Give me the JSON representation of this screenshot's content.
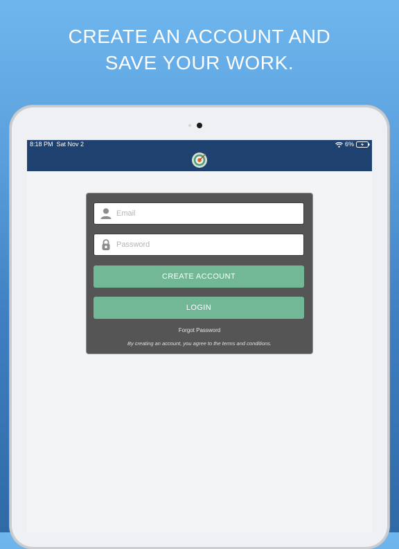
{
  "headline": {
    "line1": "CREATE AN ACCOUNT AND",
    "line2": "SAVE YOUR WORK."
  },
  "status_bar": {
    "time": "8:18 PM",
    "date": "Sat Nov 2",
    "battery_percent": "6%",
    "icons": [
      "wifi-icon",
      "battery-charging-icon"
    ]
  },
  "app": {
    "logo_icon": "target-arrow-icon"
  },
  "login_form": {
    "email": {
      "placeholder": "Email",
      "value": "",
      "icon": "user-icon"
    },
    "password": {
      "placeholder": "Password",
      "value": "",
      "icon": "padlock-icon"
    },
    "create_account_label": "CREATE ACCOUNT",
    "login_label": "LOGIN",
    "forgot_password_label": "Forgot Password",
    "terms_text": "By creating an account, you agree to the terms and conditions."
  },
  "colors": {
    "background_top": "#6fb6ee",
    "background_bottom": "#2f6aa6",
    "navbar": "#1f416f",
    "card": "#555555",
    "button": "#72b896",
    "screen": "#f3f4f6"
  }
}
